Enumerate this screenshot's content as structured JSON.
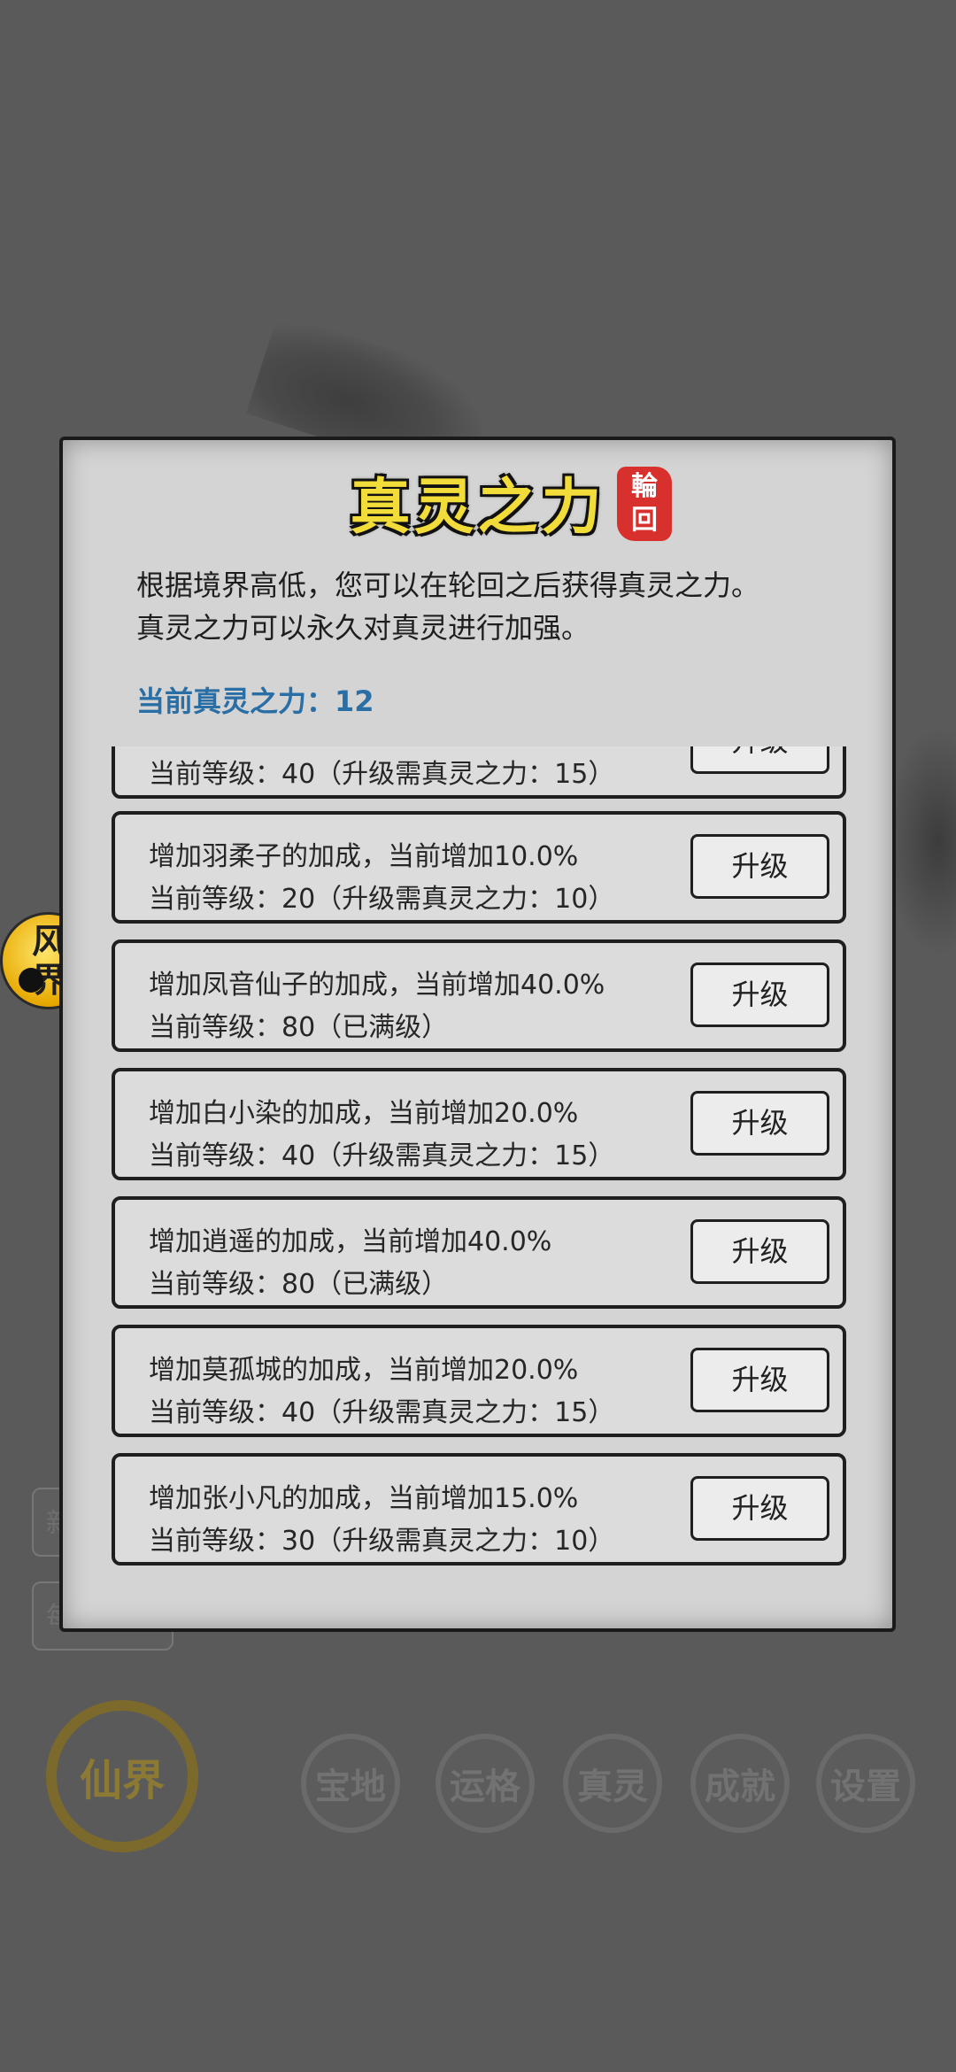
{
  "background": {
    "side_buttons": [
      "新",
      "每"
    ]
  },
  "fengjie_badge": {
    "label": "风界"
  },
  "bottom_nav": {
    "main": "仙界",
    "items": [
      "宝地",
      "运格",
      "真灵",
      "成就",
      "设置"
    ]
  },
  "modal": {
    "title": "真灵之力",
    "seal": "輪回",
    "description_lines": [
      "根据境界高低，您可以在轮回之后获得真灵之力。",
      "真灵之力可以永久对真灵进行加强。"
    ],
    "current_power_label": "当前真灵之力：",
    "current_power_value": "12",
    "upgrade_label": "升级",
    "items": [
      {
        "line1": "",
        "line2": "当前等级：40（升级需真灵之力：15）"
      },
      {
        "line1": "增加羽柔子的加成，当前增加10.0%",
        "line2": "当前等级：20（升级需真灵之力：10）"
      },
      {
        "line1": "增加凤音仙子的加成，当前增加40.0%",
        "line2": "当前等级：80（已满级）"
      },
      {
        "line1": "增加白小染的加成，当前增加20.0%",
        "line2": "当前等级：40（升级需真灵之力：15）"
      },
      {
        "line1": "增加逍遥的加成，当前增加40.0%",
        "line2": "当前等级：80（已满级）"
      },
      {
        "line1": "增加莫孤城的加成，当前增加20.0%",
        "line2": "当前等级：40（升级需真灵之力：15）"
      },
      {
        "line1": "增加张小凡的加成，当前增加15.0%",
        "line2": "当前等级：30（升级需真灵之力：10）"
      }
    ]
  }
}
